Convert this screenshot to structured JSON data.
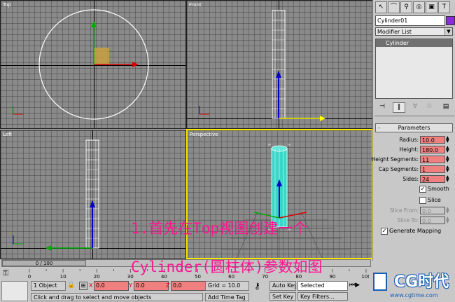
{
  "viewports": {
    "top": {
      "label": "Top"
    },
    "front": {
      "label": "Front"
    },
    "left": {
      "label": "Left"
    },
    "perspective": {
      "label": "Perspective"
    }
  },
  "panel": {
    "object_name": "Cylinder01",
    "object_color": "#8a2be2",
    "modifier_list": "Modifier List",
    "stack_item": "Cylinder",
    "rollout_title": "Parameters",
    "params": {
      "radius_label": "Radius:",
      "radius_value": "10.0",
      "height_label": "Height:",
      "height_value": "180.0",
      "height_segments_label": "Height Segments:",
      "height_segments_value": "11",
      "cap_segments_label": "Cap Segments:",
      "cap_segments_value": "1",
      "sides_label": "Sides:",
      "sides_value": "24",
      "smooth_label": "Smooth",
      "slice_label": "Slice",
      "slice_from_label": "Slice From:",
      "slice_from_value": "0.0",
      "slice_to_label": "Slice To:",
      "slice_to_value": "0.0",
      "generate_mapping_label": "Generate Mapping"
    }
  },
  "timeline": {
    "slider_label": "0 / 100",
    "ticks": [
      "0",
      "10",
      "20",
      "30",
      "40",
      "50",
      "60",
      "70",
      "80",
      "90",
      "100"
    ]
  },
  "status": {
    "selection": "1 Object",
    "x_label": "X",
    "x_value": "0.0",
    "y_label": "Y",
    "y_value": "0.0",
    "z_label": "Z",
    "z_value": "0.0",
    "grid": "Grid = 10.0",
    "auto_key": "Auto Key",
    "selected": "Selected",
    "set_key": "Set Key",
    "key_filters": "Key Filters...",
    "prompt": "Click and drag to select and move objects",
    "add_time_tag": "Add Time Tag"
  },
  "overlay": {
    "line1": "1.首先在Top视图创建一个",
    "line2": "Cylinder(圆柱体)参数如图"
  },
  "watermark": {
    "brand": "CG时代",
    "url": "www.cgtime.com"
  }
}
